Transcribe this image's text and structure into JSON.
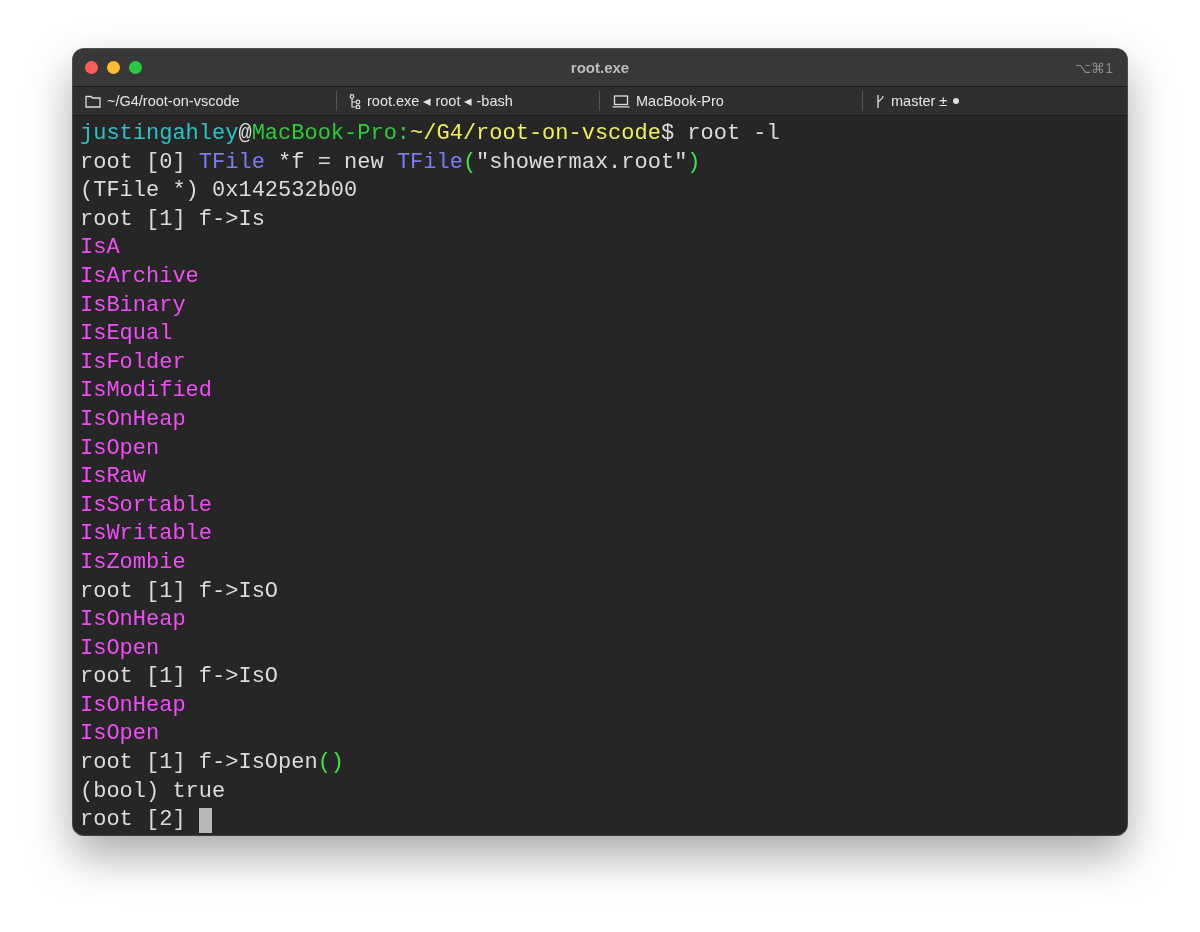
{
  "window": {
    "title": "root.exe",
    "shortcut": "⌥⌘1"
  },
  "tabs": [
    {
      "kind": "folder",
      "label": "~/G4/root-on-vscode"
    },
    {
      "kind": "process",
      "label": "root.exe ◂ root ◂ -bash"
    },
    {
      "kind": "host",
      "label": "MacBook-Pro"
    },
    {
      "kind": "git",
      "label": "master ±",
      "dirty": true
    }
  ],
  "terminal": {
    "lines": [
      [
        {
          "kind": "user",
          "text": "justingahley"
        },
        {
          "kind": "plain",
          "text": "@"
        },
        {
          "kind": "host",
          "text": "MacBook-Pro:"
        },
        {
          "kind": "path",
          "text": "~/G4/root-on-vscode"
        },
        {
          "kind": "plain",
          "text": "$ root -l"
        }
      ],
      [
        {
          "kind": "plain",
          "text": "root [0] "
        },
        {
          "kind": "type",
          "text": "TFile"
        },
        {
          "kind": "plain",
          "text": " *f = new "
        },
        {
          "kind": "type",
          "text": "TFile"
        },
        {
          "kind": "bracket",
          "text": "("
        },
        {
          "kind": "plain",
          "text": "\"showermax.root\""
        },
        {
          "kind": "bracket",
          "text": ")"
        }
      ],
      [
        {
          "kind": "plain",
          "text": "(TFile *) 0x142532b00"
        }
      ],
      [
        {
          "kind": "plain",
          "text": "root [1] f->Is"
        }
      ],
      [
        {
          "kind": "completion",
          "text": "IsA"
        }
      ],
      [
        {
          "kind": "completion",
          "text": "IsArchive"
        }
      ],
      [
        {
          "kind": "completion",
          "text": "IsBinary"
        }
      ],
      [
        {
          "kind": "completion",
          "text": "IsEqual"
        }
      ],
      [
        {
          "kind": "completion",
          "text": "IsFolder"
        }
      ],
      [
        {
          "kind": "completion",
          "text": "IsModified"
        }
      ],
      [
        {
          "kind": "completion",
          "text": "IsOnHeap"
        }
      ],
      [
        {
          "kind": "completion",
          "text": "IsOpen"
        }
      ],
      [
        {
          "kind": "completion",
          "text": "IsRaw"
        }
      ],
      [
        {
          "kind": "completion",
          "text": "IsSortable"
        }
      ],
      [
        {
          "kind": "completion",
          "text": "IsWritable"
        }
      ],
      [
        {
          "kind": "completion",
          "text": "IsZombie"
        }
      ],
      [
        {
          "kind": "plain",
          "text": "root [1] f->IsO"
        }
      ],
      [
        {
          "kind": "completion",
          "text": "IsOnHeap"
        }
      ],
      [
        {
          "kind": "completion",
          "text": "IsOpen"
        }
      ],
      [
        {
          "kind": "plain",
          "text": "root [1] f->IsO"
        }
      ],
      [
        {
          "kind": "completion",
          "text": "IsOnHeap"
        }
      ],
      [
        {
          "kind": "completion",
          "text": "IsOpen"
        }
      ],
      [
        {
          "kind": "plain",
          "text": "root [1] f->IsOpen"
        },
        {
          "kind": "bracket",
          "text": "()"
        }
      ],
      [
        {
          "kind": "plain",
          "text": "(bool) true"
        }
      ],
      [
        {
          "kind": "plain",
          "text": "root [2] "
        }
      ]
    ],
    "cursor": true
  }
}
